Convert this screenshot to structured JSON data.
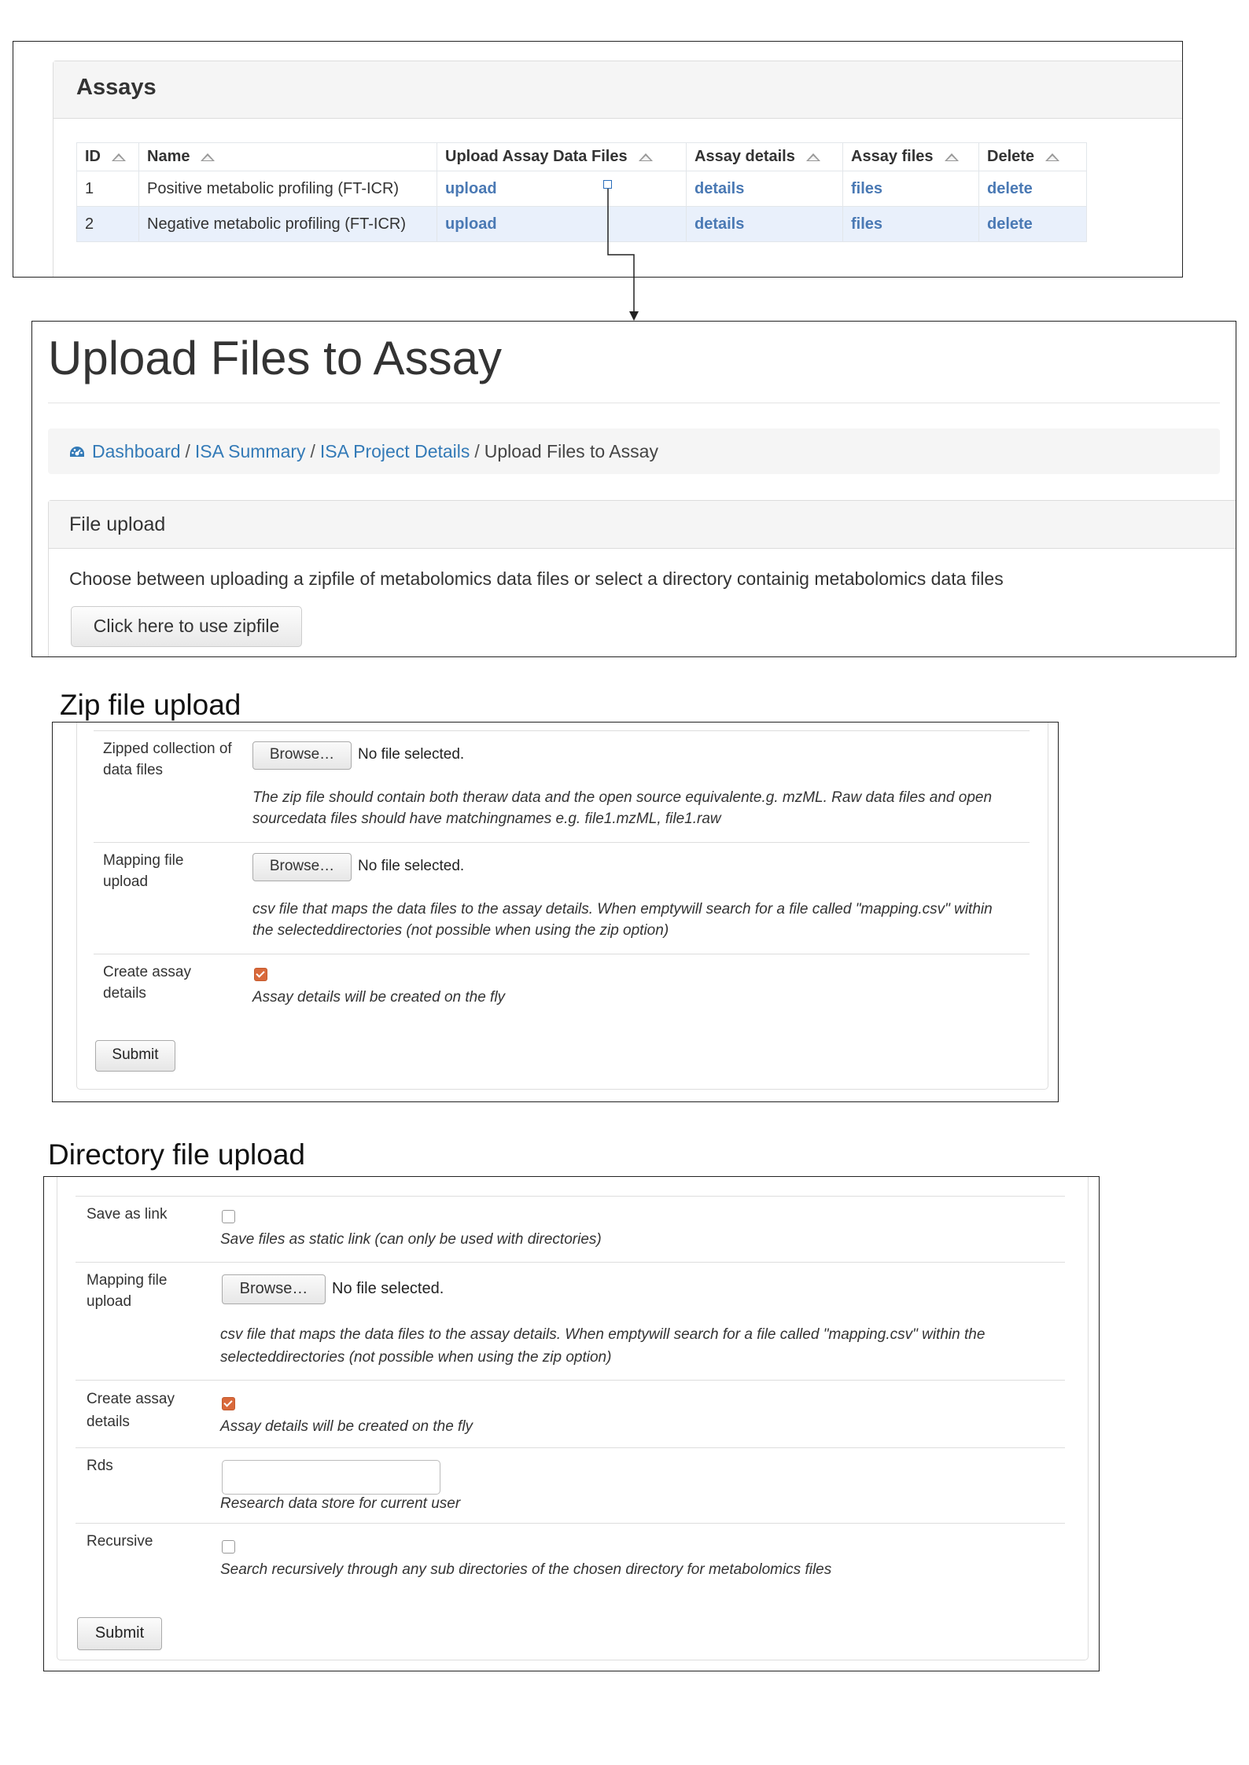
{
  "assays": {
    "title": "Assays",
    "columns": [
      "ID",
      "Name",
      "Upload Assay Data Files",
      "Assay details",
      "Assay files",
      "Delete"
    ],
    "rows": [
      {
        "id": "1",
        "name": "Positive metabolic profiling (FT-ICR)",
        "upload": "upload",
        "details": "details",
        "files": "files",
        "delete": "delete"
      },
      {
        "id": "2",
        "name": "Negative metabolic profiling (FT-ICR)",
        "upload": "upload",
        "details": "details",
        "files": "files",
        "delete": "delete"
      }
    ]
  },
  "upload_page": {
    "title": "Upload Files to Assay",
    "breadcrumb": {
      "icon": "dashboard-icon",
      "items": [
        "Dashboard",
        "ISA Summary",
        "ISA Project Details"
      ],
      "current": "Upload Files to Assay",
      "separator": "/"
    },
    "panel_title": "File upload",
    "description": "Choose between uploading a zipfile of metabolomics data files or select a directory containig metabolomics data files",
    "zip_button": "Click here to use zipfile"
  },
  "zip_section": {
    "title": "Zip file upload",
    "zipped_label": "Zipped collection of data files",
    "browse_label": "Browse…",
    "no_file": "No file selected.",
    "zipped_help": "The zip file should contain both theraw data and the open source equivalente.g. mzML. Raw data files and open sourcedata files should have matchingnames e.g. file1.mzML, file1.raw",
    "mapping_label": "Mapping file upload",
    "mapping_help": "csv file that maps the data files to the assay details. When emptywill search for a file called \"mapping.csv\" within the selecteddirectories (not possible when using the zip option)",
    "create_label": "Create assay details",
    "create_checked": true,
    "create_help": "Assay details will be created on the fly",
    "submit": "Submit"
  },
  "dir_section": {
    "title": "Directory file upload",
    "save_link_label": "Save as link",
    "save_link_checked": false,
    "save_link_help": "Save files as static link (can only be used with directories)",
    "mapping_label": "Mapping file upload",
    "browse_label": "Browse…",
    "no_file": "No file selected.",
    "mapping_help": "csv file that maps the data files to the assay details. When emptywill search for a file called \"mapping.csv\" within the selecteddirectories (not possible when using the zip option)",
    "create_label": "Create assay details",
    "create_checked": true,
    "create_help": "Assay details will be created on the fly",
    "rds_label": "Rds",
    "rds_value": "",
    "rds_help": "Research data store for current user",
    "recursive_label": "Recursive",
    "recursive_checked": false,
    "recursive_help": "Search recursively through any sub directories of the chosen directory for metabolomics files",
    "submit": "Submit"
  },
  "colors": {
    "link": "#337ab7",
    "checkbox_checked": "#d9693b",
    "row_highlight": "#e9f0fb",
    "connector": "#2a6ebb"
  }
}
